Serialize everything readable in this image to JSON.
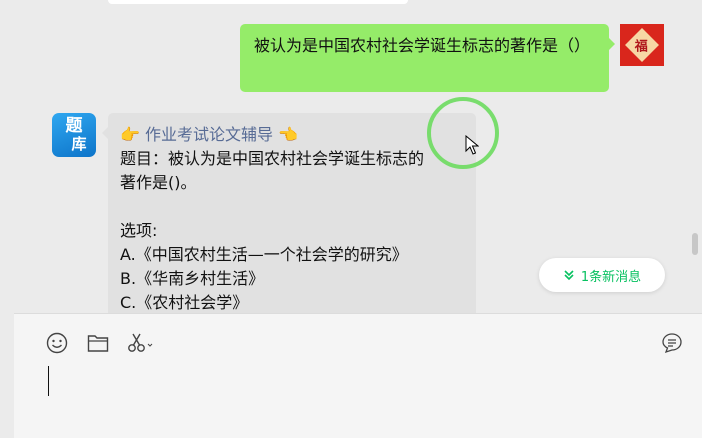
{
  "chat": {
    "outgoing_message": "被认为是中国农村社会学诞生标志的著作是（）",
    "outgoing_avatar_char": "福",
    "incoming_avatar": {
      "line1": "题",
      "line2": "库"
    },
    "incoming": {
      "header_icon_left": "👉",
      "header_text": "作业考试论文辅导",
      "header_icon_right": "👈",
      "question_line1": "题目：被认为是中国农村社会学诞生标志的",
      "question_line2": "著作是()。",
      "options_label": "选项:",
      "option_a": "A.《中国农村生活—一个社会学的研究》",
      "option_b": "B.《华南乡村生活》",
      "option_c": "C.《农村社会学》"
    },
    "new_message_pill": "1条新消息"
  },
  "toolbar": {
    "icons": [
      "emoji-icon",
      "folder-icon",
      "scissors-icon",
      "chat-history-icon"
    ]
  },
  "colors": {
    "outgoing_bubble": "#95ec69",
    "incoming_bubble": "#e1e1e1",
    "accent_green": "#07c160",
    "link_blue": "#576b95"
  }
}
